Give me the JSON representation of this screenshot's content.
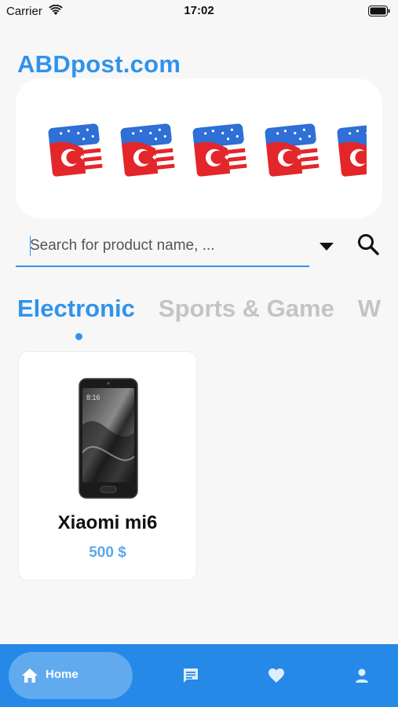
{
  "status_bar": {
    "carrier": "Carrier",
    "time": "17:02",
    "icons": [
      "wifi-icon",
      "battery-icon"
    ]
  },
  "brand": {
    "title": "ABDpost.com"
  },
  "banner": {
    "logos": [
      "flag-logo",
      "flag-logo",
      "flag-logo",
      "flag-logo",
      "flag-logo"
    ]
  },
  "search": {
    "placeholder": "Search for product name, ...",
    "value": "",
    "icons": [
      "dropdown-arrow-icon",
      "search-icon"
    ]
  },
  "tabs": [
    {
      "label": "Electronic",
      "active": true
    },
    {
      "label": "Sports & Game",
      "active": false
    },
    {
      "label": "W",
      "active": false
    }
  ],
  "products": [
    {
      "name": "Xiaomi mi6",
      "price": "500 $",
      "image": "smartphone-image"
    }
  ],
  "bottom_nav": {
    "items": [
      {
        "label": "Home",
        "icon": "home-icon",
        "active": true
      },
      {
        "label": "",
        "icon": "chat-icon",
        "active": false
      },
      {
        "label": "",
        "icon": "heart-icon",
        "active": false
      },
      {
        "label": "",
        "icon": "person-icon",
        "active": false
      }
    ]
  },
  "colors": {
    "accent": "#2f93ec",
    "nav_bg": "#2689e8",
    "price": "#5aa9ee",
    "inactive_tab": "#c4c4c4"
  }
}
